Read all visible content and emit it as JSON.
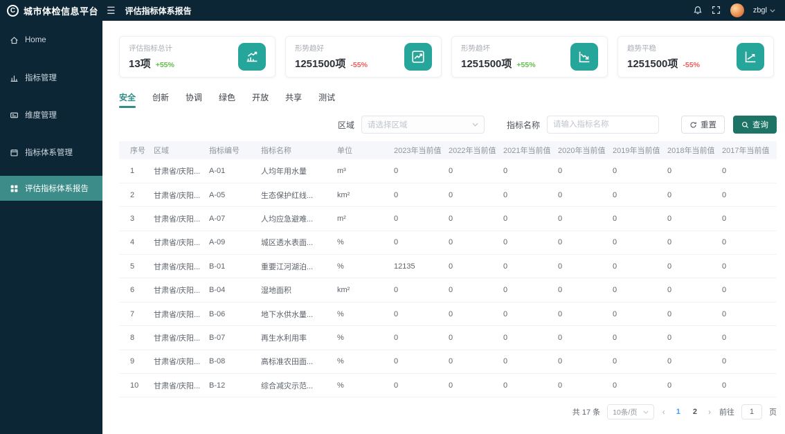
{
  "app": {
    "logo_letter": "C",
    "logo_text": "城市体检信息平台",
    "page_title": "评估指标体系报告",
    "username": "zbgl"
  },
  "sidebar": {
    "items": [
      {
        "label": "Home"
      },
      {
        "label": "指标管理"
      },
      {
        "label": "维度管理"
      },
      {
        "label": "指标体系管理"
      },
      {
        "label": "评估指标体系报告"
      }
    ]
  },
  "cards": [
    {
      "title": "评估指标总计",
      "value": "13项",
      "delta": "+55%",
      "trend": "up",
      "icon": "bar-chart-rising-icon"
    },
    {
      "title": "形势趋好",
      "value": "1251500项",
      "delta": "-55%",
      "trend": "down",
      "icon": "line-chart-up-icon"
    },
    {
      "title": "形势趋坏",
      "value": "1251500项",
      "delta": "+55%",
      "trend": "up",
      "icon": "line-chart-down-icon"
    },
    {
      "title": "趋势平稳",
      "value": "1251500项",
      "delta": "-55%",
      "trend": "down",
      "icon": "trend-axis-icon"
    }
  ],
  "tabs": {
    "items": [
      "安全",
      "创新",
      "协调",
      "绿色",
      "开放",
      "共享",
      "测试"
    ],
    "active": "安全"
  },
  "filters": {
    "region_label": "区域",
    "region_placeholder": "请选择区域",
    "name_label": "指标名称",
    "name_placeholder": "请输入指标名称",
    "reset_label": "重置",
    "query_label": "查询"
  },
  "table": {
    "headers": [
      "序号",
      "区域",
      "指标编号",
      "指标名称",
      "单位",
      "2023年当前值",
      "2022年当前值",
      "2021年当前值",
      "2020年当前值",
      "2019年当前值",
      "2018年当前值",
      "2017年当前值"
    ],
    "rows": [
      [
        "1",
        "甘肃省/庆阳...",
        "A-01",
        "人均年用水量",
        "m³",
        "0",
        "0",
        "0",
        "0",
        "0",
        "0",
        "0"
      ],
      [
        "2",
        "甘肃省/庆阳...",
        "A-05",
        "生态保护红线...",
        "km²",
        "0",
        "0",
        "0",
        "0",
        "0",
        "0",
        "0"
      ],
      [
        "3",
        "甘肃省/庆阳...",
        "A-07",
        "人均应急避难...",
        "m²",
        "0",
        "0",
        "0",
        "0",
        "0",
        "0",
        "0"
      ],
      [
        "4",
        "甘肃省/庆阳...",
        "A-09",
        "城区透水表面...",
        "%",
        "0",
        "0",
        "0",
        "0",
        "0",
        "0",
        "0"
      ],
      [
        "5",
        "甘肃省/庆阳...",
        "B-01",
        "重要江河湖泊...",
        "%",
        "12135",
        "0",
        "0",
        "0",
        "0",
        "0",
        "0"
      ],
      [
        "6",
        "甘肃省/庆阳...",
        "B-04",
        "湿地面积",
        "km²",
        "0",
        "0",
        "0",
        "0",
        "0",
        "0",
        "0"
      ],
      [
        "7",
        "甘肃省/庆阳...",
        "B-06",
        "地下水供水量...",
        "%",
        "0",
        "0",
        "0",
        "0",
        "0",
        "0",
        "0"
      ],
      [
        "8",
        "甘肃省/庆阳...",
        "B-07",
        "再生水利用率",
        "%",
        "0",
        "0",
        "0",
        "0",
        "0",
        "0",
        "0"
      ],
      [
        "9",
        "甘肃省/庆阳...",
        "B-08",
        "高标准农田面...",
        "%",
        "0",
        "0",
        "0",
        "0",
        "0",
        "0",
        "0"
      ],
      [
        "10",
        "甘肃省/庆阳...",
        "B-12",
        "综合减灾示范...",
        "%",
        "0",
        "0",
        "0",
        "0",
        "0",
        "0",
        "0"
      ]
    ]
  },
  "pagination": {
    "total_label": "共 17 条",
    "page_size_label": "10条/页",
    "pages": [
      "1",
      "2"
    ],
    "active_page": "1",
    "goto_label": "前往",
    "goto_value": "1",
    "goto_suffix": "页"
  }
}
